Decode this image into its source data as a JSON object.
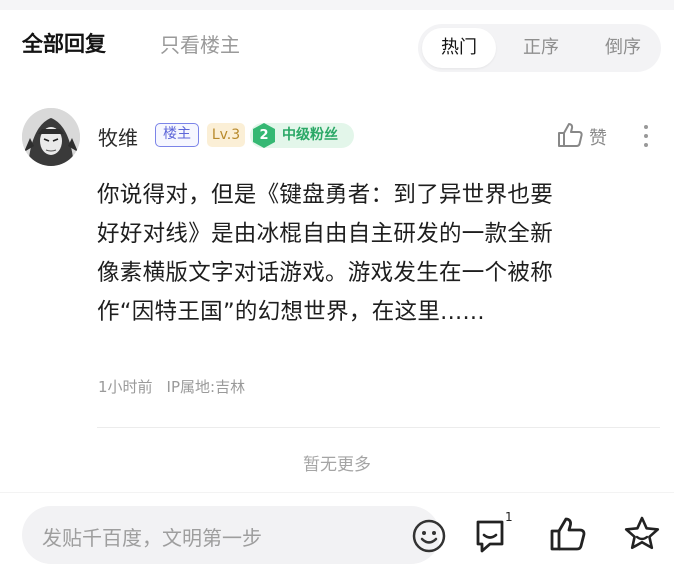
{
  "header": {
    "tab_all": "全部回复",
    "tab_host_only": "只看楼主",
    "sort": {
      "hot": "热门",
      "asc": "正序",
      "desc": "倒序",
      "selected": "热门"
    }
  },
  "comment": {
    "username": "牧维",
    "host_badge": "楼主",
    "level": "Lv.3",
    "fan_level": "2",
    "fan_label": "中级粉丝",
    "like_label": "赞",
    "lines": [
      "你说得对，但是《键盘勇者：到了异世界也要",
      "好好对线》是由冰棍自由自主研发的一款全新",
      "像素横版文字对话游戏。游戏发生在一个被称",
      "作“因特王国”的幻想世界，在这里......"
    ],
    "time": "1小时前",
    "ip_location": "IP属地:吉林"
  },
  "footer": {
    "no_more": "暂无更多"
  },
  "bottom_bar": {
    "placeholder": "发贴千百度，文明第一步",
    "comment_count": "1"
  },
  "colors": {
    "host_badge": "#5d66d8",
    "level": "#b88a2c",
    "fan_badge": "#2aa866",
    "muted_text": "#9a9a9a"
  }
}
